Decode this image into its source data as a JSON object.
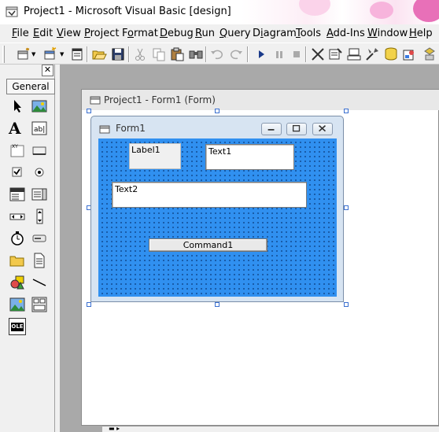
{
  "window": {
    "title": "Project1 - Microsoft Visual Basic [design]"
  },
  "menu": [
    {
      "label": "File",
      "key": "F"
    },
    {
      "label": "Edit",
      "key": "E"
    },
    {
      "label": "View",
      "key": "V"
    },
    {
      "label": "Project",
      "key": "P"
    },
    {
      "label": "Format",
      "key": "o"
    },
    {
      "label": "Debug",
      "key": "D"
    },
    {
      "label": "Run",
      "key": "R"
    },
    {
      "label": "Query",
      "key": "Q"
    },
    {
      "label": "Diagram",
      "key": "i"
    },
    {
      "label": "Tools",
      "key": "T"
    },
    {
      "label": "Add-Ins",
      "key": "A"
    },
    {
      "label": "Window",
      "key": "W"
    },
    {
      "label": "Help",
      "key": "H"
    }
  ],
  "toolbar_icons": [
    "add-project-icon",
    "add-form-icon",
    "menu-editor-icon",
    "open-project-icon",
    "save-project-icon",
    "cut-icon",
    "copy-icon",
    "paste-icon",
    "find-icon",
    "undo-icon",
    "redo-icon",
    "start-icon",
    "break-icon",
    "end-icon",
    "project-explorer-icon",
    "properties-window-icon",
    "form-layout-icon",
    "object-browser-icon",
    "data-view-icon",
    "toolbox-icon"
  ],
  "toolbox": {
    "tab_label": "General",
    "tools": [
      "pointer-icon",
      "picturebox-icon",
      "label-icon",
      "textbox-icon",
      "frame-icon",
      "commandbutton-icon",
      "checkbox-icon",
      "optionbutton-icon",
      "combobox-icon",
      "listbox-icon",
      "hscrollbar-icon",
      "vscrollbar-icon",
      "timer-icon",
      "drivelistbox-icon",
      "dirlistbox-icon",
      "filelistbox-icon",
      "shape-icon",
      "line-icon",
      "image-icon",
      "data-icon",
      "ole-icon"
    ],
    "ole_text": "OLE"
  },
  "designer": {
    "title": "Project1 - Form1 (Form)"
  },
  "form": {
    "title": "Form1",
    "client_color": "#3090f0",
    "label1": "Label1",
    "text1": "Text1",
    "text2": "Text2",
    "command1": "Command1"
  }
}
